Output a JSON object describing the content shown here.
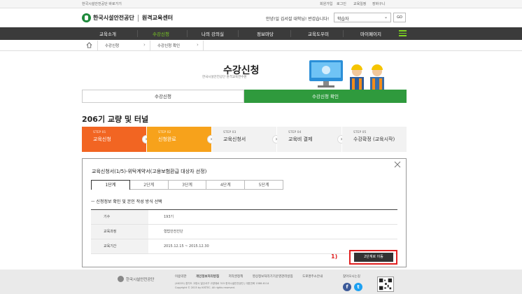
{
  "topbar": {
    "site_link": "한국시설안전공단 바로가기",
    "links": [
      "회원가입",
      "로그인",
      "교육일정",
      "장바구니"
    ]
  },
  "header": {
    "logo_main": "한국시설안전공단",
    "logo_sub": "원격교육센터",
    "greeting": "안녕!일 김서설 대학님! 반갑습니다!",
    "role_value": "학습자",
    "go_label": "GO"
  },
  "nav": {
    "items": [
      "교육소개",
      "수강신청",
      "나의 강의실",
      "정보마당",
      "교육도우미",
      "마이페이지"
    ],
    "active_index": 1,
    "accent": "#7ed321"
  },
  "breadcrumb": {
    "level1": "수강신청",
    "level2": "수강신청 확인"
  },
  "hero": {
    "title": "수강신청",
    "subtitle": "한국시설안전공단 원격교육연수원"
  },
  "tabs": [
    "수강신청",
    "수강신청 확인"
  ],
  "course_title": "206기 교량 및 터널",
  "steps": [
    {
      "num": "STEP 01",
      "label": "교육신청",
      "bg": "#f26522",
      "fg": "#ffffff"
    },
    {
      "num": "STEP 02",
      "label": "신청완료",
      "bg": "#f7a21b",
      "fg": "#ffffff"
    },
    {
      "num": "STEP 03",
      "label": "교육신청서",
      "bg": "#f2f2f2",
      "fg": "#333333"
    },
    {
      "num": "STEP 04",
      "label": "교육비 결제",
      "bg": "#f2f2f2",
      "fg": "#333333"
    },
    {
      "num": "STEP 05",
      "label": "수강확정 (교육시작)",
      "bg": "#f2f2f2",
      "fg": "#333333"
    }
  ],
  "modal": {
    "title": "교육신청서(1/5)-위탁계약서(고용보험환급 대상자 선정)",
    "subtabs": [
      "1단계",
      "2단계",
      "3단계",
      "4단계",
      "5단계"
    ],
    "section_head": "ㅡ 신청정보 확인 및 본인 작성 방식 선택",
    "rows": [
      {
        "label": "기수",
        "value": "193기"
      },
      {
        "label": "교육과정",
        "value": "형탑안전진단"
      },
      {
        "label": "교육기간",
        "value": "2015.12.15 ~ 2015.12.30"
      }
    ],
    "annotation": "1)",
    "next_button": "2단계로 이동"
  },
  "footer": {
    "logo": "한국시설안전공단",
    "links": [
      "이용약관",
      "개인정보처리방침",
      "저작권정책",
      "영상정보처리기기운영관리방침",
      "도로명주소안내",
      "찾아오시는길"
    ],
    "address": "(46225) 경기도 고양시 일산서구 고양대로 315 한국시설안전공단 | 대표전화 1588-6114",
    "copyright": "Copyright © 2015 by KISTEC. All rights reserved.",
    "sns": [
      {
        "name": "facebook",
        "glyph": "f",
        "color": "#3b5998"
      },
      {
        "name": "twitter",
        "glyph": "t",
        "color": "#1da1f2"
      }
    ]
  }
}
